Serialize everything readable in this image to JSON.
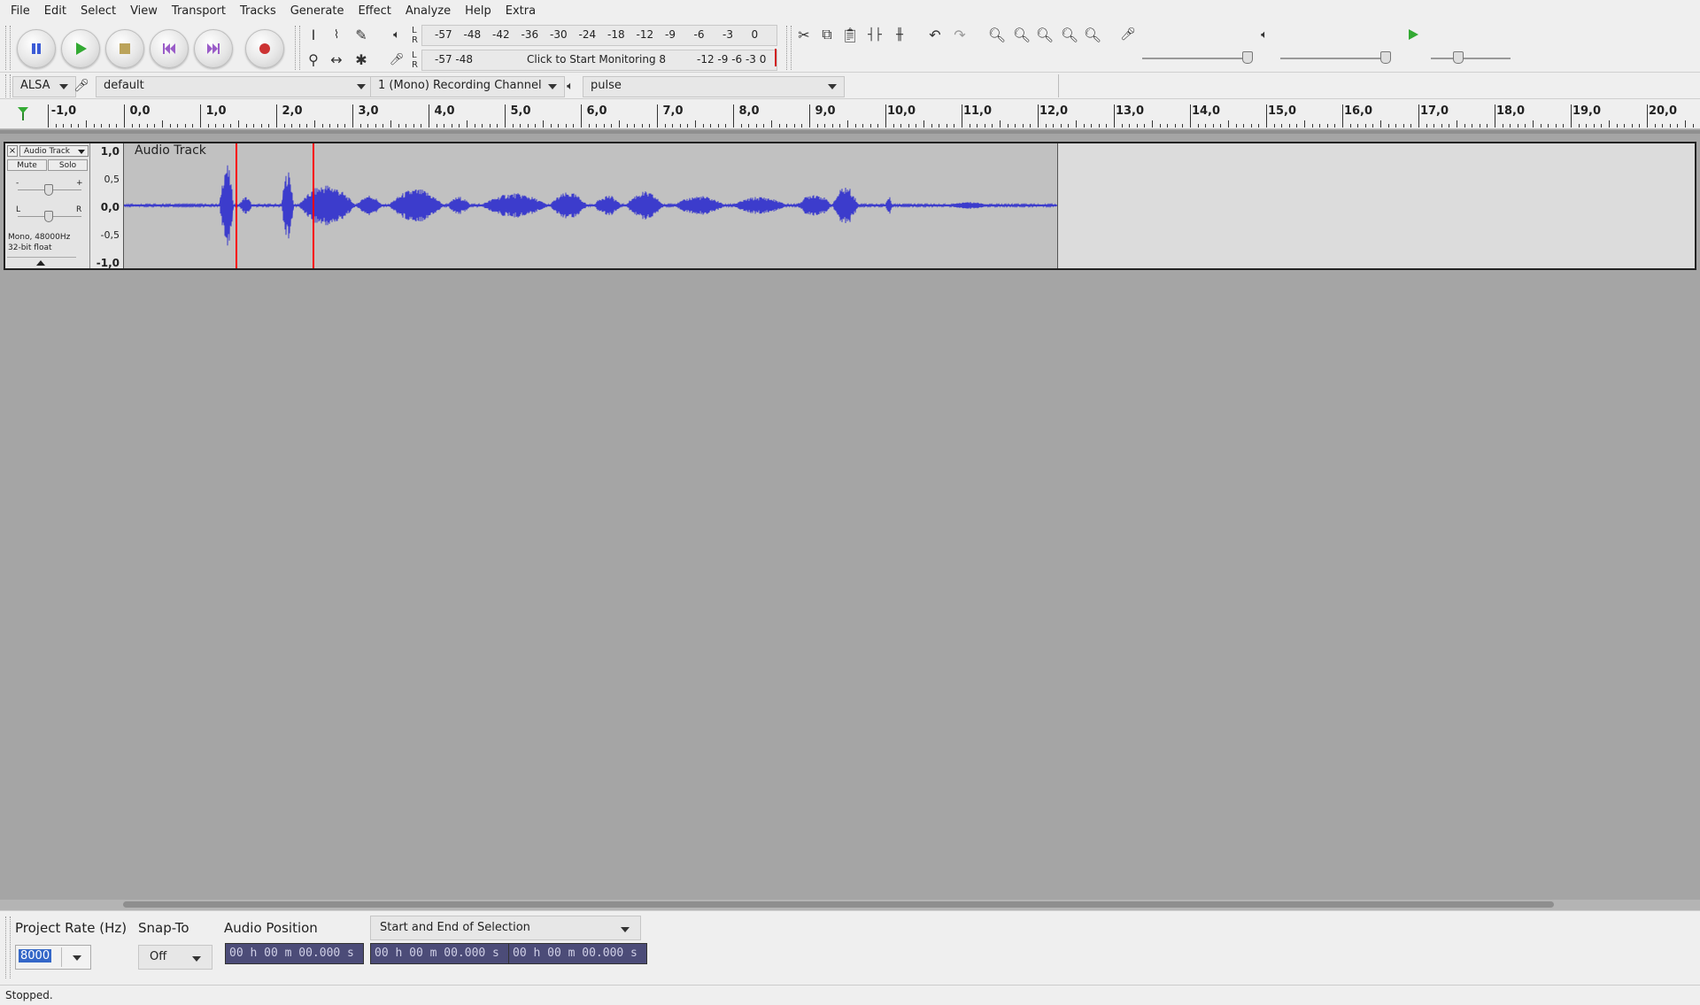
{
  "menu": [
    "File",
    "Edit",
    "Select",
    "View",
    "Transport",
    "Tracks",
    "Generate",
    "Effect",
    "Analyze",
    "Help",
    "Extra"
  ],
  "meters": {
    "record_scale": [
      "-57",
      "-48",
      "-42",
      "-36",
      "-30",
      "-24",
      "-18",
      "-12",
      "-9",
      "-6",
      "-3",
      "0"
    ],
    "play_scale": [
      "-57",
      "-48",
      "-12",
      "-9",
      "-6",
      "-3",
      "0"
    ],
    "monitor_prompt": "Click to Start Monitoring",
    "monitor_extra": "8",
    "l": "L",
    "r": "R"
  },
  "device": {
    "host": "ALSA",
    "recording_device": "default",
    "channels": "1 (Mono) Recording Channel",
    "playback_device": "pulse"
  },
  "ruler": {
    "labels": [
      "-1,0",
      "0,0",
      "1,0",
      "2,0",
      "3,0",
      "4,0",
      "5,0",
      "6,0",
      "7,0",
      "8,0",
      "9,0",
      "10,0",
      "11,0",
      "12,0",
      "13,0",
      "14,0",
      "15,0",
      "16,0",
      "17,0",
      "18,0",
      "19,0",
      "20,0"
    ]
  },
  "track": {
    "name": "Audio Track",
    "clip_name": "Audio Track",
    "mute": "Mute",
    "solo": "Solo",
    "gain_minus": "-",
    "gain_plus": "+",
    "pan_left": "L",
    "pan_right": "R",
    "info_line1": "Mono, 48000Hz",
    "info_line2": "32-bit float",
    "vscale": [
      "1,0",
      "0,5",
      "0,0",
      "-0,5",
      "-1,0"
    ]
  },
  "bottom": {
    "project_rate_label": "Project Rate (Hz)",
    "project_rate_value": "8000",
    "snap_label": "Snap-To",
    "snap_value": "Off",
    "audio_position_label": "Audio Position",
    "selection_mode": "Start and End of Selection",
    "audio_position_value": "00 h 00 m 00.000 s",
    "selection_start": "00 h 00 m 00.000 s",
    "selection_end": "00 h 00 m 00.000 s"
  },
  "status": "Stopped.",
  "colors": {
    "waveform": "#3c3ccc",
    "clip_name": "#ffff00",
    "cursor": "#ff0000",
    "play_green": "#33aa33",
    "record_red": "#cc3333"
  }
}
